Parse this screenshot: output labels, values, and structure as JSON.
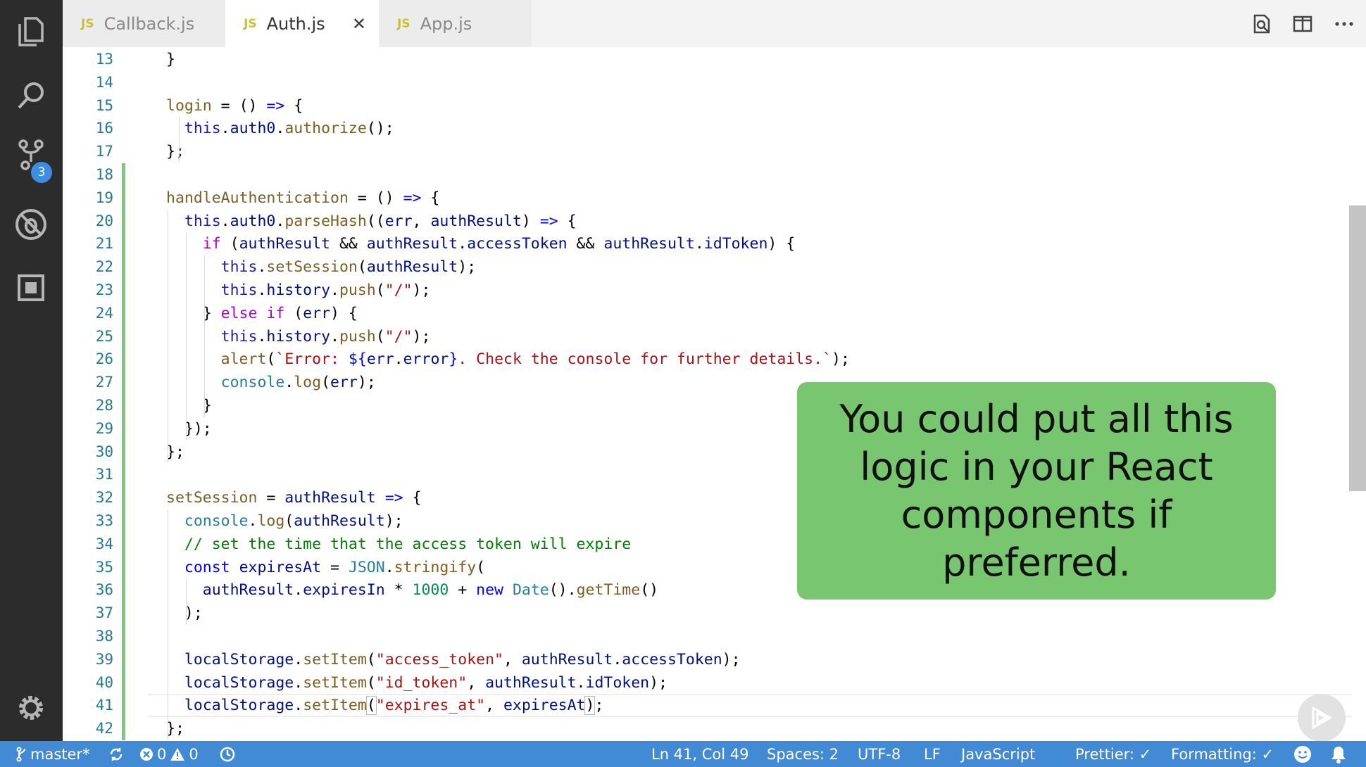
{
  "tabs": [
    {
      "icon": "JS",
      "label": "Callback.js"
    },
    {
      "icon": "JS",
      "label": "Auth.js",
      "close": "✕"
    },
    {
      "icon": "JS",
      "label": "App.js"
    }
  ],
  "activity": {
    "scm_badge": "3"
  },
  "editor": {
    "current_line": 41,
    "lines": [
      {
        "n": "13",
        "t": [
          [
            "p",
            "}"
          ]
        ]
      },
      {
        "n": "14",
        "t": []
      },
      {
        "n": "15",
        "t": [
          [
            "fn",
            "login"
          ],
          [
            "p",
            " = () "
          ],
          [
            "kw",
            "=>"
          ],
          [
            "p",
            " {"
          ]
        ]
      },
      {
        "n": "16",
        "t": [
          [
            "p",
            "  "
          ],
          [
            "th",
            "this"
          ],
          [
            "p",
            "."
          ],
          [
            "var",
            "auth0"
          ],
          [
            "p",
            "."
          ],
          [
            "fn",
            "authorize"
          ],
          [
            "p",
            "();"
          ]
        ]
      },
      {
        "n": "17",
        "t": [
          [
            "p",
            "};"
          ]
        ]
      },
      {
        "n": "18",
        "t": []
      },
      {
        "n": "19",
        "t": [
          [
            "fn",
            "handleAuthentication"
          ],
          [
            "p",
            " = () "
          ],
          [
            "kw",
            "=>"
          ],
          [
            "p",
            " {"
          ]
        ]
      },
      {
        "n": "20",
        "t": [
          [
            "p",
            "  "
          ],
          [
            "th",
            "this"
          ],
          [
            "p",
            "."
          ],
          [
            "var",
            "auth0"
          ],
          [
            "p",
            "."
          ],
          [
            "fn",
            "parseHash"
          ],
          [
            "p",
            "(("
          ],
          [
            "var",
            "err"
          ],
          [
            "p",
            ", "
          ],
          [
            "var",
            "authResult"
          ],
          [
            "p",
            ") "
          ],
          [
            "kw",
            "=>"
          ],
          [
            "p",
            " {"
          ]
        ]
      },
      {
        "n": "21",
        "t": [
          [
            "p",
            "    "
          ],
          [
            "ctl",
            "if"
          ],
          [
            "p",
            " ("
          ],
          [
            "var",
            "authResult"
          ],
          [
            "p",
            " && "
          ],
          [
            "var",
            "authResult"
          ],
          [
            "p",
            "."
          ],
          [
            "var",
            "accessToken"
          ],
          [
            "p",
            " && "
          ],
          [
            "var",
            "authResult"
          ],
          [
            "p",
            "."
          ],
          [
            "var",
            "idToken"
          ],
          [
            "p",
            ") {"
          ]
        ]
      },
      {
        "n": "22",
        "t": [
          [
            "p",
            "      "
          ],
          [
            "th",
            "this"
          ],
          [
            "p",
            "."
          ],
          [
            "fn",
            "setSession"
          ],
          [
            "p",
            "("
          ],
          [
            "var",
            "authResult"
          ],
          [
            "p",
            ");"
          ]
        ]
      },
      {
        "n": "23",
        "t": [
          [
            "p",
            "      "
          ],
          [
            "th",
            "this"
          ],
          [
            "p",
            "."
          ],
          [
            "var",
            "history"
          ],
          [
            "p",
            "."
          ],
          [
            "fn",
            "push"
          ],
          [
            "p",
            "("
          ],
          [
            "str",
            "\"/\""
          ],
          [
            "p",
            ");"
          ]
        ]
      },
      {
        "n": "24",
        "t": [
          [
            "p",
            "    } "
          ],
          [
            "ctl",
            "else"
          ],
          [
            "p",
            " "
          ],
          [
            "ctl",
            "if"
          ],
          [
            "p",
            " ("
          ],
          [
            "var",
            "err"
          ],
          [
            "p",
            ") {"
          ]
        ]
      },
      {
        "n": "25",
        "t": [
          [
            "p",
            "      "
          ],
          [
            "th",
            "this"
          ],
          [
            "p",
            "."
          ],
          [
            "var",
            "history"
          ],
          [
            "p",
            "."
          ],
          [
            "fn",
            "push"
          ],
          [
            "p",
            "("
          ],
          [
            "str",
            "\"/\""
          ],
          [
            "p",
            ");"
          ]
        ]
      },
      {
        "n": "26",
        "t": [
          [
            "p",
            "      "
          ],
          [
            "fn",
            "alert"
          ],
          [
            "p",
            "("
          ],
          [
            "str",
            "`Error: "
          ],
          [
            "kw",
            "${"
          ],
          [
            "var",
            "err"
          ],
          [
            "p",
            "."
          ],
          [
            "var",
            "error"
          ],
          [
            "kw",
            "}"
          ],
          [
            "str",
            ". Check the console for further details.`"
          ],
          [
            "p",
            ");"
          ]
        ]
      },
      {
        "n": "27",
        "t": [
          [
            "p",
            "      "
          ],
          [
            "type",
            "console"
          ],
          [
            "p",
            "."
          ],
          [
            "fn",
            "log"
          ],
          [
            "p",
            "("
          ],
          [
            "var",
            "err"
          ],
          [
            "p",
            ");"
          ]
        ]
      },
      {
        "n": "28",
        "t": [
          [
            "p",
            "    }"
          ]
        ]
      },
      {
        "n": "29",
        "t": [
          [
            "p",
            "  });"
          ]
        ]
      },
      {
        "n": "30",
        "t": [
          [
            "p",
            "};"
          ]
        ]
      },
      {
        "n": "31",
        "t": []
      },
      {
        "n": "32",
        "t": [
          [
            "fn",
            "setSession"
          ],
          [
            "p",
            " = "
          ],
          [
            "var",
            "authResult"
          ],
          [
            "p",
            " "
          ],
          [
            "kw",
            "=>"
          ],
          [
            "p",
            " {"
          ]
        ]
      },
      {
        "n": "33",
        "t": [
          [
            "p",
            "  "
          ],
          [
            "type",
            "console"
          ],
          [
            "p",
            "."
          ],
          [
            "fn",
            "log"
          ],
          [
            "p",
            "("
          ],
          [
            "var",
            "authResult"
          ],
          [
            "p",
            ");"
          ]
        ]
      },
      {
        "n": "34",
        "t": [
          [
            "p",
            "  "
          ],
          [
            "cmt",
            "// set the time that the access token will expire"
          ]
        ]
      },
      {
        "n": "35",
        "t": [
          [
            "p",
            "  "
          ],
          [
            "kw",
            "const"
          ],
          [
            "p",
            " "
          ],
          [
            "var",
            "expiresAt"
          ],
          [
            "p",
            " = "
          ],
          [
            "type",
            "JSON"
          ],
          [
            "p",
            "."
          ],
          [
            "fn",
            "stringify"
          ],
          [
            "p",
            "("
          ]
        ]
      },
      {
        "n": "36",
        "t": [
          [
            "p",
            "    "
          ],
          [
            "var",
            "authResult"
          ],
          [
            "p",
            "."
          ],
          [
            "var",
            "expiresIn"
          ],
          [
            "p",
            " * "
          ],
          [
            "num",
            "1000"
          ],
          [
            "p",
            " + "
          ],
          [
            "kw",
            "new"
          ],
          [
            "p",
            " "
          ],
          [
            "type",
            "Date"
          ],
          [
            "p",
            "()."
          ],
          [
            "fn",
            "getTime"
          ],
          [
            "p",
            "()"
          ]
        ]
      },
      {
        "n": "37",
        "t": [
          [
            "p",
            "  );"
          ]
        ]
      },
      {
        "n": "38",
        "t": []
      },
      {
        "n": "39",
        "t": [
          [
            "p",
            "  "
          ],
          [
            "var",
            "localStorage"
          ],
          [
            "p",
            "."
          ],
          [
            "fn",
            "setItem"
          ],
          [
            "p",
            "("
          ],
          [
            "str",
            "\"access_token\""
          ],
          [
            "p",
            ", "
          ],
          [
            "var",
            "authResult"
          ],
          [
            "p",
            "."
          ],
          [
            "var",
            "accessToken"
          ],
          [
            "p",
            ");"
          ]
        ]
      },
      {
        "n": "40",
        "t": [
          [
            "p",
            "  "
          ],
          [
            "var",
            "localStorage"
          ],
          [
            "p",
            "."
          ],
          [
            "fn",
            "setItem"
          ],
          [
            "p",
            "("
          ],
          [
            "str",
            "\"id_token\""
          ],
          [
            "p",
            ", "
          ],
          [
            "var",
            "authResult"
          ],
          [
            "p",
            "."
          ],
          [
            "var",
            "idToken"
          ],
          [
            "p",
            ");"
          ]
        ]
      },
      {
        "n": "41",
        "t": [
          [
            "p",
            "  "
          ],
          [
            "var",
            "localStorage"
          ],
          [
            "p",
            "."
          ],
          [
            "fn",
            "setItem"
          ],
          [
            "p bm",
            "("
          ],
          [
            "str",
            "\"expires_at\""
          ],
          [
            "p",
            ", "
          ],
          [
            "var",
            "expiresAt"
          ],
          [
            "p bm",
            ")"
          ],
          [
            "p",
            ";"
          ]
        ]
      },
      {
        "n": "42",
        "t": [
          [
            "p",
            "};"
          ]
        ]
      }
    ]
  },
  "callout": {
    "text": "You could put all this logic in your React components if preferred.",
    "color": "#78c670"
  },
  "status": {
    "branch": "master*",
    "errors": "0",
    "warnings": "0",
    "position": "Ln 41, Col 49",
    "spaces": "Spaces: 2",
    "encoding": "UTF-8",
    "eol": "LF",
    "language": "JavaScript",
    "prettier": "Prettier: ✓",
    "formatting": "Formatting: ✓",
    "color": "#428bd4"
  }
}
